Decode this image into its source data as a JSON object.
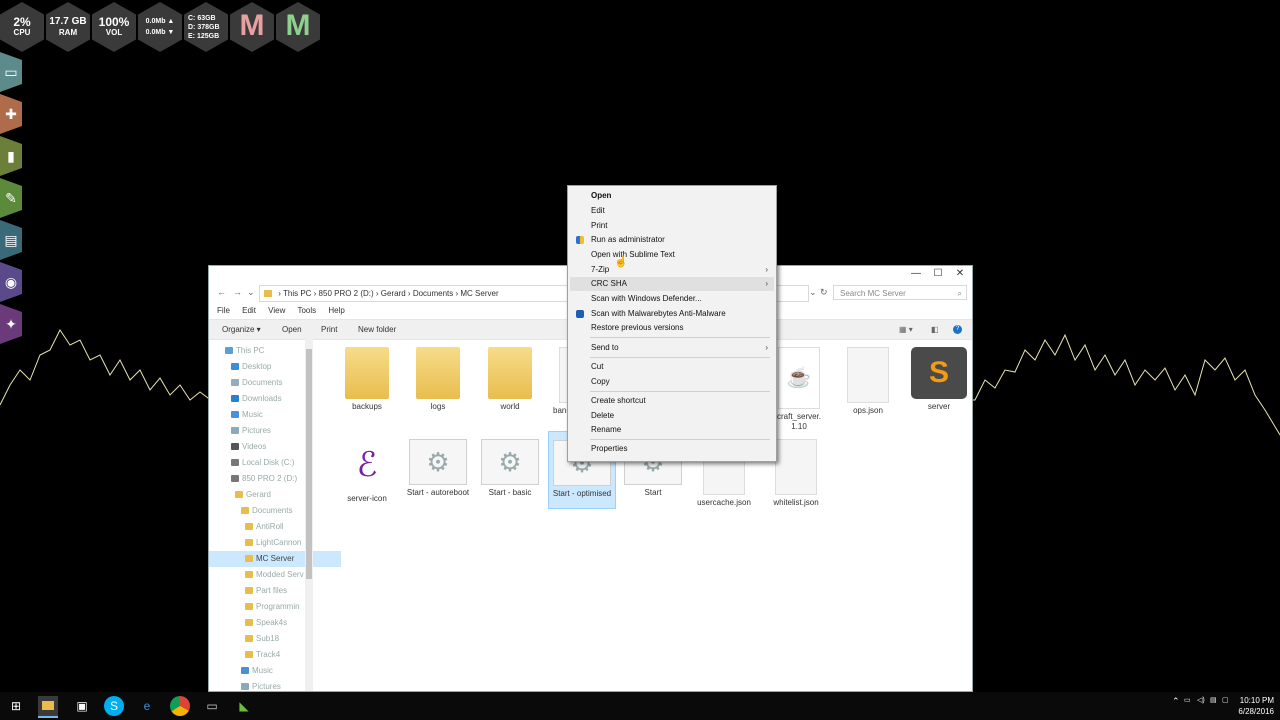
{
  "widgets": {
    "cpu": {
      "value": "2%",
      "label": "CPU"
    },
    "ram": {
      "value": "17.7 GB",
      "label": "RAM"
    },
    "vol": {
      "value": "100%",
      "label": "VOL"
    },
    "net": {
      "up": "0.0Mb ▲",
      "down": "0.0Mb ▼"
    },
    "drives": {
      "c": "C: 63GB",
      "d": "D: 378GB",
      "e": "E: 125GB"
    },
    "m1": "M",
    "m2": "M"
  },
  "sidebar_icons": [
    "monitor-icon",
    "medkit-icon",
    "office-icon",
    "edit-icon",
    "film-icon",
    "camera-icon",
    "gamepad-icon"
  ],
  "window": {
    "path": [
      "This PC",
      "850 PRO 2 (D:)",
      "Gerard",
      "Documents",
      "MC Server"
    ],
    "search_placeholder": "Search MC Server",
    "menu": [
      "File",
      "Edit",
      "View",
      "Tools",
      "Help"
    ],
    "commands": {
      "organize": "Organize ▾",
      "open": "Open",
      "print": "Print",
      "new_folder": "New folder"
    },
    "nav": [
      "This PC",
      "Desktop",
      "Documents",
      "Downloads",
      "Music",
      "Pictures",
      "Videos",
      "Local Disk (C:)",
      "850 PRO 2 (D:)",
      "Gerard",
      "Documents",
      "AntiRoll",
      "LightCannon",
      "MC Server",
      "Modded Serv",
      "Part files",
      "Programmin",
      "Speak4s",
      "Sub18",
      "Track4",
      "Music",
      "Pictures"
    ],
    "files": [
      {
        "name": "backups",
        "kind": "folder"
      },
      {
        "name": "logs",
        "kind": "folder"
      },
      {
        "name": "world",
        "kind": "folder"
      },
      {
        "name": "banne",
        "kind": "doc"
      },
      {
        "name": "craft_server.\n1.10",
        "kind": "java"
      },
      {
        "name": "ops.json",
        "kind": "doc"
      },
      {
        "name": "server",
        "kind": "sublime"
      },
      {
        "name": "server-icon",
        "kind": "image"
      },
      {
        "name": "Start - autoreboot",
        "kind": "gear"
      },
      {
        "name": "Start - basic",
        "kind": "gear"
      },
      {
        "name": "Start - optimised",
        "kind": "gear"
      },
      {
        "name": "Start",
        "kind": "gear"
      },
      {
        "name": "usercache.json",
        "kind": "doc"
      },
      {
        "name": "whitelist.json",
        "kind": "doc"
      }
    ]
  },
  "context_menu": {
    "items": [
      {
        "label": "Open",
        "bold": true
      },
      {
        "label": "Edit"
      },
      {
        "label": "Print"
      },
      {
        "label": "Run as administrator",
        "icon": "shield-icon"
      },
      {
        "label": "Open with Sublime Text"
      },
      {
        "label": "7-Zip",
        "submenu": true
      },
      {
        "label": "CRC SHA",
        "submenu": true,
        "highlighted": true
      },
      {
        "label": "Scan with Windows Defender..."
      },
      {
        "label": "Scan with Malwarebytes Anti-Malware",
        "icon": "malwarebytes-icon"
      },
      {
        "label": "Restore previous versions"
      },
      {
        "label": "Send to",
        "submenu": true
      },
      {
        "label": "Cut"
      },
      {
        "label": "Copy"
      },
      {
        "label": "Create shortcut"
      },
      {
        "label": "Delete"
      },
      {
        "label": "Rename"
      },
      {
        "label": "Properties"
      }
    ]
  },
  "taskbar": {
    "clock_time": "10:10 PM",
    "clock_date": "6/28/2016"
  },
  "colors": {
    "accent_selected": "#cce8ff",
    "taskbar": "#0a0a0a",
    "wave": "#e8e4b0"
  }
}
